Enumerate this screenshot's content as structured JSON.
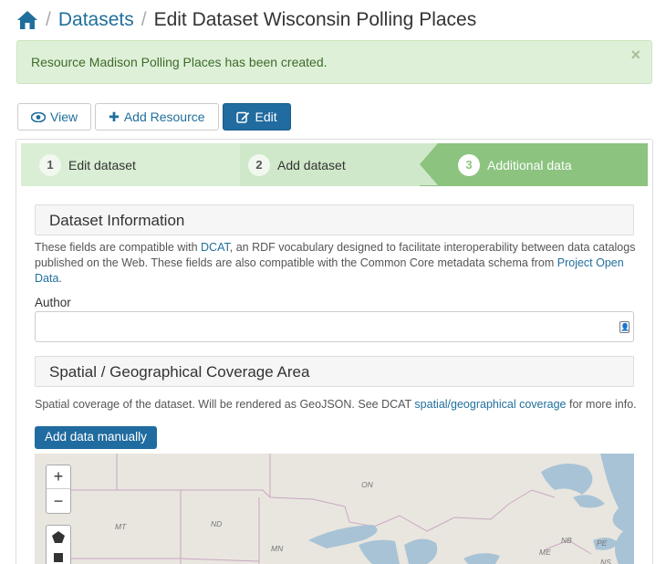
{
  "breadcrumb": {
    "home_icon": "home-icon",
    "datasets": "Datasets",
    "current": "Edit Dataset Wisconsin Polling Places",
    "separator": "/"
  },
  "alert": {
    "message": "Resource Madison Polling Places has been created.",
    "close": "×"
  },
  "actions": {
    "view": "View",
    "add_resource": "Add Resource",
    "edit": "Edit"
  },
  "stages": [
    {
      "num": "1",
      "label": "Edit dataset"
    },
    {
      "num": "2",
      "label": "Add dataset"
    },
    {
      "num": "3",
      "label": "Additional data"
    }
  ],
  "dataset_info": {
    "title": "Dataset Information",
    "help_pre": "These fields are compatible with ",
    "help_link1": "DCAT",
    "help_mid": ", an RDF vocabulary designed to facilitate interoperability between data catalogs published on the Web. These fields are also compatible with the Common Core metadata schema from ",
    "help_link2": "Project Open Data",
    "help_post": "."
  },
  "author": {
    "label": "Author",
    "value": ""
  },
  "spatial": {
    "title": "Spatial / Geographical Coverage Area",
    "help_pre": "Spatial coverage of the dataset. Will be rendered as GeoJSON. See DCAT ",
    "help_link": "spatial/geographical coverage",
    "help_post": " for more info.",
    "add_button": "Add data manually"
  },
  "map": {
    "zoom_in": "+",
    "zoom_out": "−",
    "labels": [
      "ON",
      "MT",
      "ND",
      "MN",
      "NB",
      "PE",
      "ME",
      "NS"
    ]
  },
  "colors": {
    "accent": "#206b9f",
    "stage_active": "#8bc37f",
    "alert_bg": "#dff0d8"
  }
}
